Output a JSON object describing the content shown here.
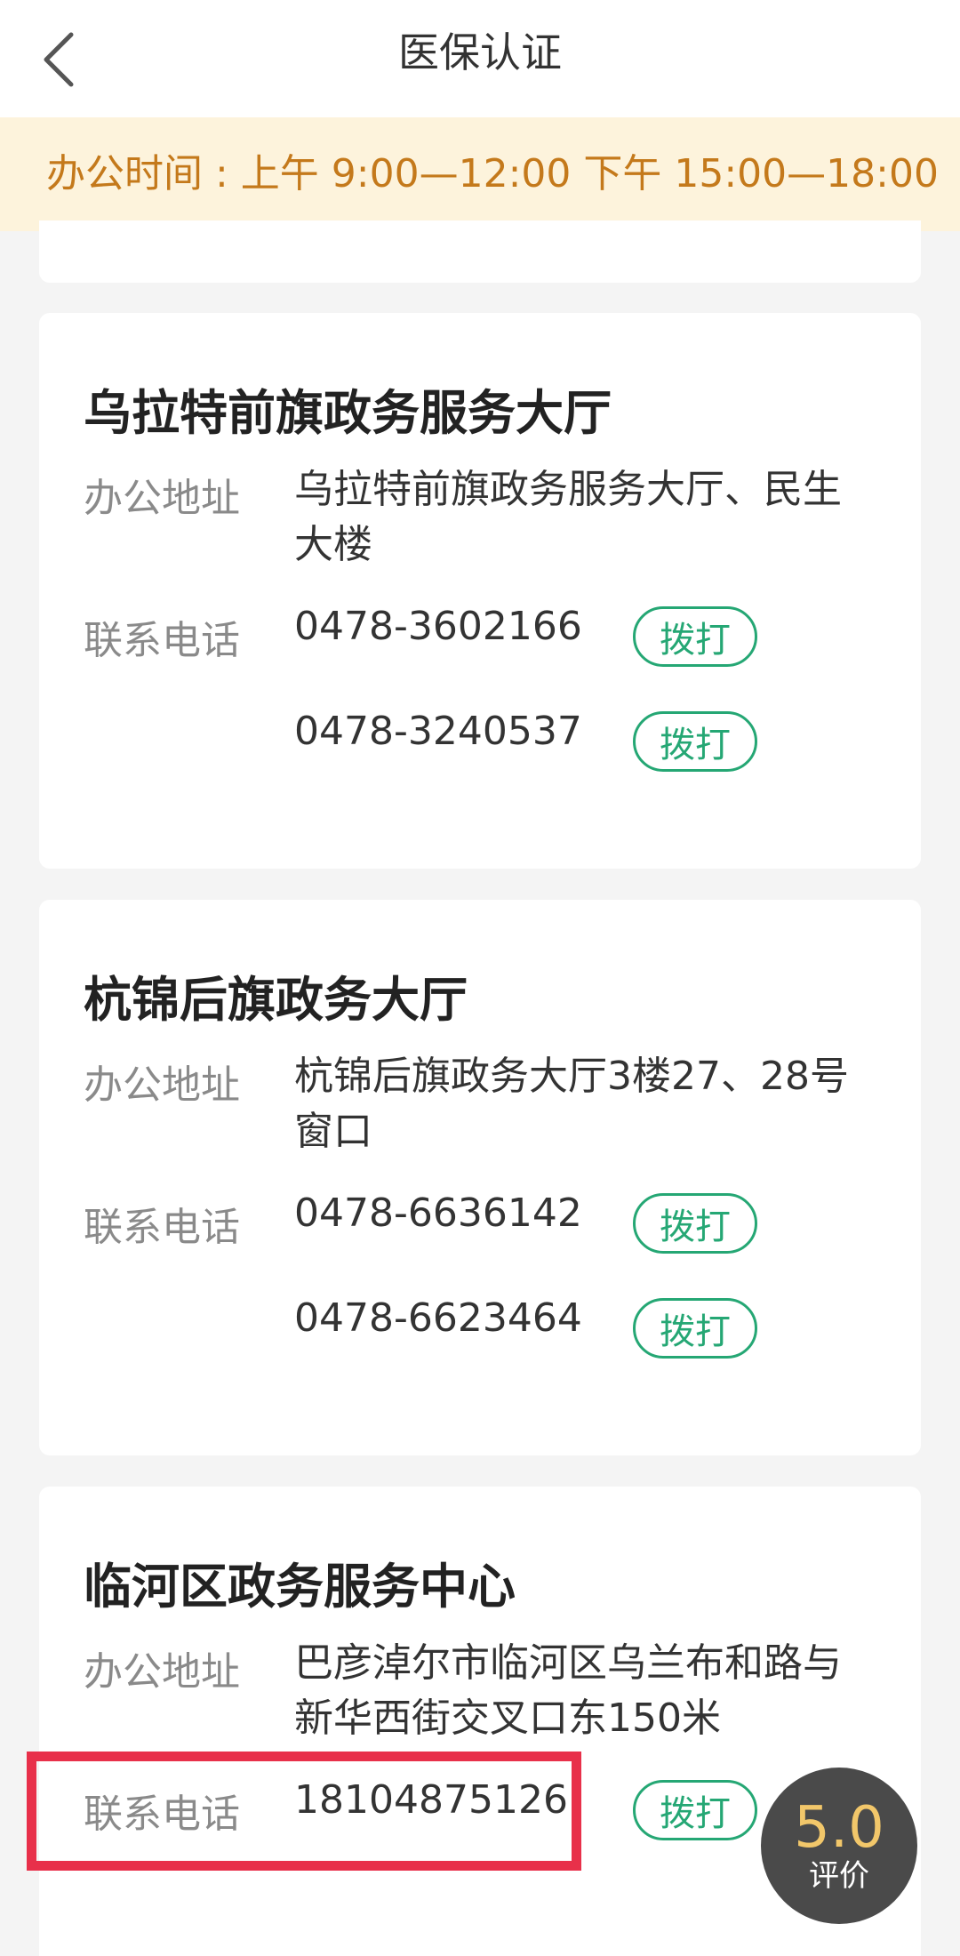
{
  "header": {
    "title": "医保认证",
    "back_icon": "chevron-left-icon"
  },
  "notice": {
    "text": "办公时间 : 上午 9:00—12:00 下午 15:00—18:00"
  },
  "offices": [
    {
      "name": "乌拉特前旗政务服务大厅",
      "address_label": "办公地址",
      "address": "乌拉特前旗政务服务大厅、民生大楼",
      "phone_label": "联系电话",
      "phones": [
        "0478-3602166",
        "0478-3240537"
      ],
      "call_label": "拨打"
    },
    {
      "name": "杭锦后旗政务大厅",
      "address_label": "办公地址",
      "address": "杭锦后旗政务大厅3楼27、28号窗口",
      "phone_label": "联系电话",
      "phones": [
        "0478-6636142",
        "0478-6623464"
      ],
      "call_label": "拨打"
    },
    {
      "name": "临河区政务服务中心",
      "address_label": "办公地址",
      "address": "巴彦淖尔市临河区乌兰布和路与新华西街交叉口东150米",
      "phone_label": "联系电话",
      "phones": [
        "18104875126"
      ],
      "call_label": "拨打"
    }
  ],
  "rating": {
    "score": "5.0",
    "label": "评价"
  },
  "colors": {
    "accent": "#25a774",
    "notice_text": "#c4791b",
    "notice_bg": "#fdf3dc",
    "highlight": "#e8304a",
    "rating_score": "#f2c76a"
  }
}
